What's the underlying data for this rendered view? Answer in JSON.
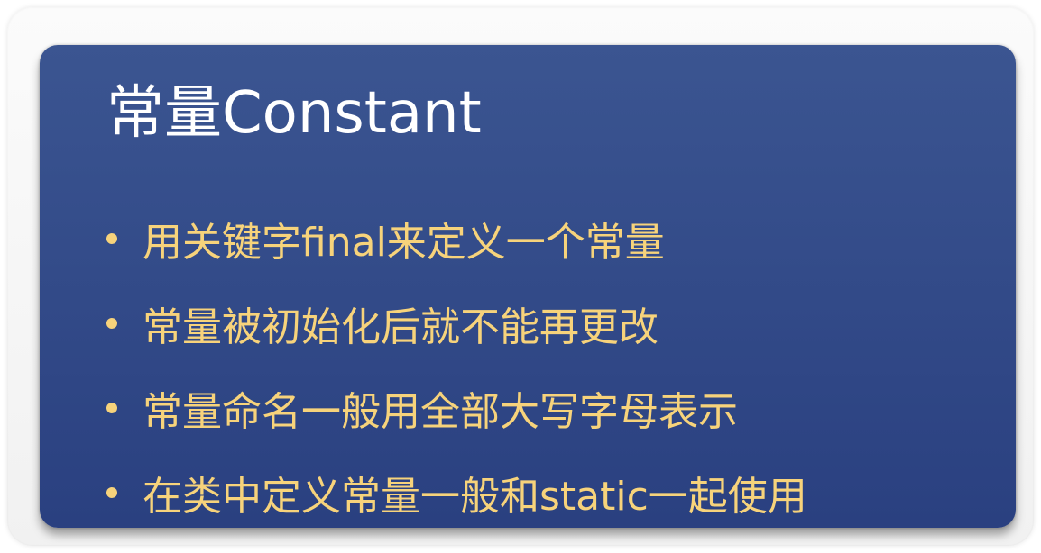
{
  "slide": {
    "title": "常量Constant",
    "bullets": [
      "用关键字final来定义一个常量",
      "常量被初始化后就不能再更改",
      "常量命名一般用全部大写字母表示",
      "在类中定义常量一般和static一起使用"
    ]
  },
  "colors": {
    "background": "#2f4a89",
    "title": "#ffffff",
    "bullet_text": "#f7d37b"
  }
}
